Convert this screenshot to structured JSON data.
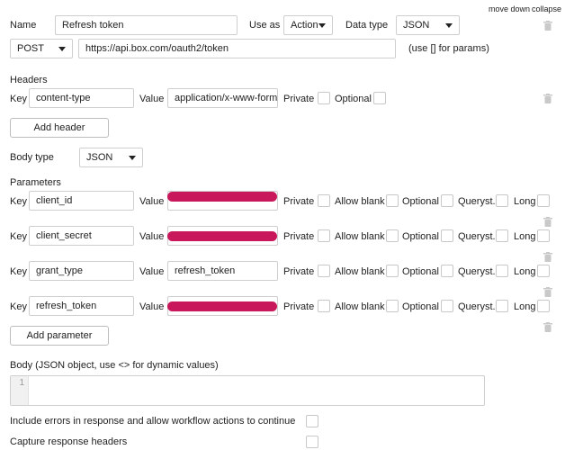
{
  "top": {
    "move_down": "move down",
    "collapse": "collapse"
  },
  "row1": {
    "name_label": "Name",
    "name_value": "Refresh token",
    "use_as_label": "Use as",
    "use_as_value": "Action",
    "data_type_label": "Data type",
    "data_type_value": "JSON"
  },
  "request": {
    "method": "POST",
    "url": "https://api.box.com/oauth2/token",
    "hint": "(use [] for params)"
  },
  "headers": {
    "title": "Headers",
    "key_label": "Key",
    "key_value": "content-type",
    "value_label": "Value",
    "value_value": "application/x-www-form-u",
    "private_label": "Private",
    "optional_label": "Optional",
    "add_button": "Add header"
  },
  "body_type": {
    "label": "Body type",
    "value": "JSON"
  },
  "parameters": {
    "title": "Parameters",
    "key_label": "Key",
    "value_label": "Value",
    "private_label": "Private",
    "allow_blank_label": "Allow blank",
    "optional_label": "Optional",
    "queryst_label": "Queryst.",
    "long_label": "Long",
    "rows": [
      {
        "key": "client_id",
        "value": ""
      },
      {
        "key": "client_secret",
        "value": ""
      },
      {
        "key": "grant_type",
        "value": "refresh_token"
      },
      {
        "key": "refresh_token",
        "value": ""
      }
    ],
    "add_button": "Add parameter"
  },
  "body": {
    "label": "Body (JSON object, use <> for dynamic values)",
    "line_number": "1"
  },
  "options": {
    "include_errors": "Include errors in response and allow workflow actions to continue",
    "capture_headers": "Capture response headers"
  },
  "colors": {
    "redaction": "#c8175a",
    "border": "#cfcfcf"
  }
}
